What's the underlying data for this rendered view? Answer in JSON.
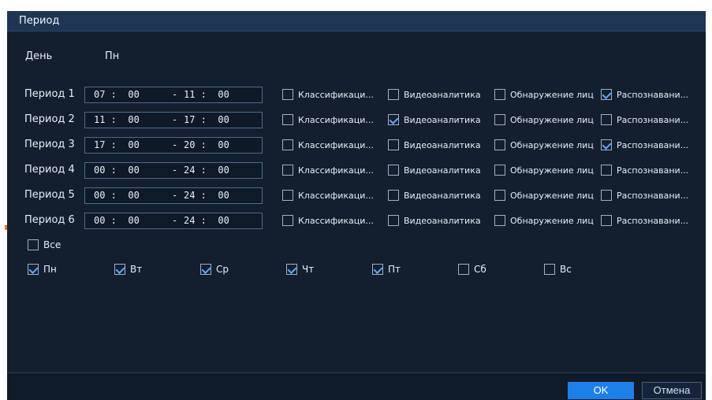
{
  "dialog": {
    "title": "Период",
    "day_label": "День",
    "day_value": "Пн"
  },
  "columns": [
    "Классификаци...",
    "Видеоаналитика",
    "Обнаружение лиц",
    "Распознавани..."
  ],
  "periods": [
    {
      "label": "Период 1",
      "start": "07 :  00",
      "end": "11 :  00",
      "checks": [
        false,
        false,
        false,
        true
      ]
    },
    {
      "label": "Период 2",
      "start": "11 :  00",
      "end": "17 :  00",
      "checks": [
        false,
        true,
        false,
        false
      ]
    },
    {
      "label": "Период 3",
      "start": "17 :  00",
      "end": "20 :  00",
      "checks": [
        false,
        false,
        false,
        true
      ]
    },
    {
      "label": "Период 4",
      "start": "00 :  00",
      "end": "24 :  00",
      "checks": [
        false,
        false,
        false,
        false
      ]
    },
    {
      "label": "Период 5",
      "start": "00 :  00",
      "end": "24 :  00",
      "checks": [
        false,
        false,
        false,
        false
      ]
    },
    {
      "label": "Период 6",
      "start": "00 :  00",
      "end": "24 :  00",
      "checks": [
        false,
        false,
        false,
        false
      ]
    }
  ],
  "time_separator": "-",
  "all": {
    "label": "Все",
    "checked": false
  },
  "weekdays": [
    {
      "label": "Пн",
      "checked": true
    },
    {
      "label": "Вт",
      "checked": true
    },
    {
      "label": "Ср",
      "checked": true
    },
    {
      "label": "Чт",
      "checked": true
    },
    {
      "label": "Пт",
      "checked": true
    },
    {
      "label": "Сб",
      "checked": false
    },
    {
      "label": "Вс",
      "checked": false
    }
  ],
  "buttons": {
    "ok": "OK",
    "cancel": "Отмена"
  },
  "colors": {
    "background": "#131f2f",
    "titlebar": "#1e3553",
    "accent": "#1f7fe8",
    "check": "#5fa8ff"
  }
}
